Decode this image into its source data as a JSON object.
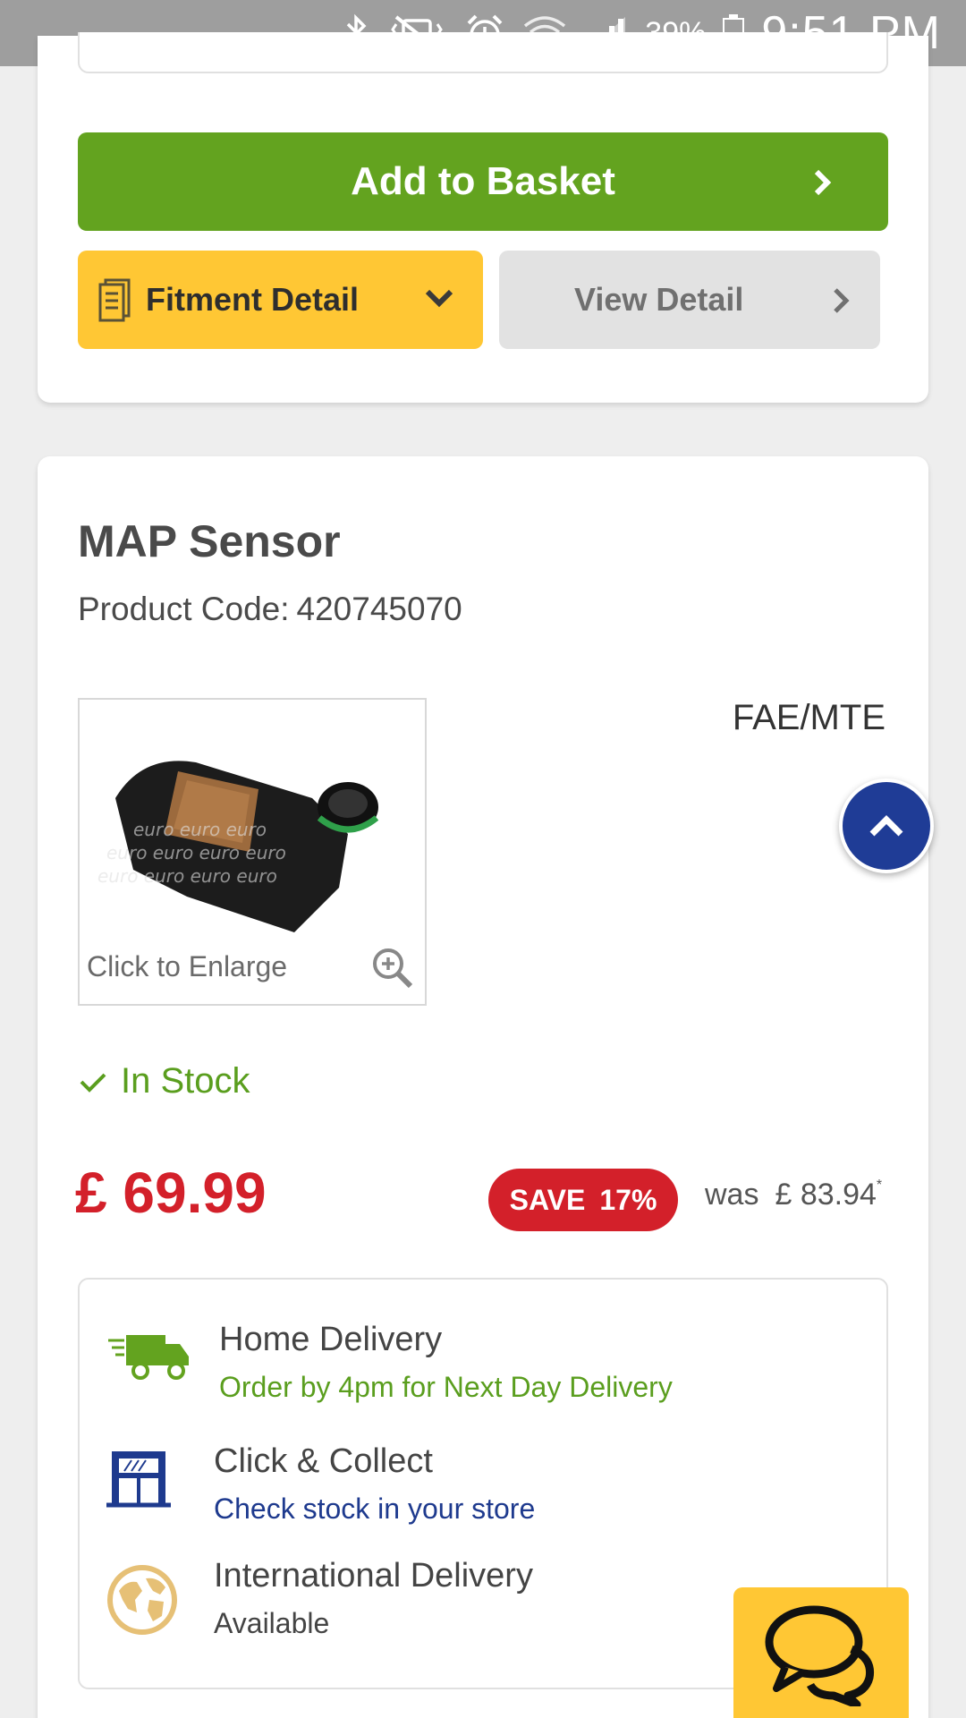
{
  "status_bar": {
    "battery_pct": "39%",
    "time": "9:51 PM",
    "icons": [
      "bluetooth-icon",
      "vibrate-icon",
      "alarm-icon",
      "wifi-icon",
      "signal-icon",
      "battery-icon"
    ]
  },
  "actions": {
    "add_to_basket": "Add to Basket",
    "fitment_detail": "Fitment Detail",
    "view_detail": "View Detail"
  },
  "product": {
    "title": "MAP Sensor",
    "code_label": "Product Code:",
    "code": "420745070",
    "image_caption": "Click to Enlarge",
    "brand": "FAE/MTE",
    "stock": "In Stock",
    "price": "£ 69.99",
    "save_label": "SAVE",
    "save_pct": "17%",
    "was_label": "was",
    "was_price": "£ 83.94",
    "was_marker": "*"
  },
  "delivery": {
    "home": {
      "title": "Home Delivery",
      "sub": "Order by 4pm for Next Day Delivery"
    },
    "collect": {
      "title": "Click & Collect",
      "sub": "Check stock in your store"
    },
    "international": {
      "title": "International Delivery",
      "sub": "Available"
    }
  },
  "colors": {
    "green": "#63a31f",
    "yellow": "#ffc734",
    "red": "#d3202a",
    "navy": "#1f3c96"
  }
}
